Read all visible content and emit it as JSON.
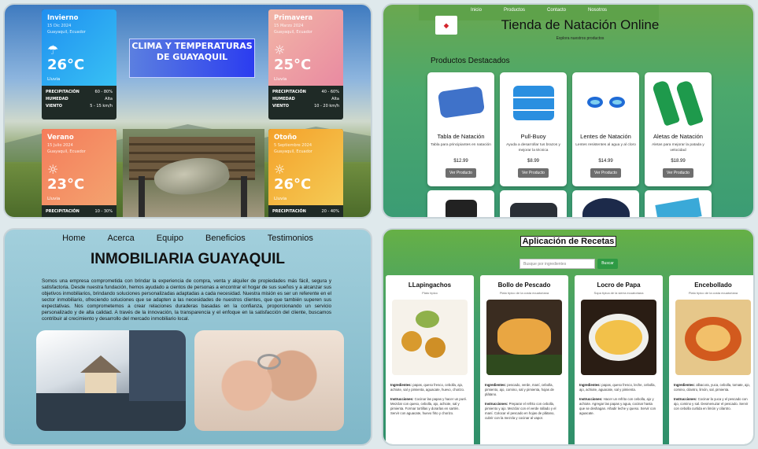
{
  "weather": {
    "title": "CLIMA Y TEMPERATURAS DE GUAYAQUIL",
    "cards": [
      {
        "season": "Invierno",
        "date": "15 Dic 2024",
        "place": "Guayaquil, Ecuador",
        "temp": "26°C",
        "cond": "Lluvia",
        "icon": "cloud-rain-icon",
        "rows": [
          {
            "k": "PRECIPITACIÓN",
            "v": "60 - 80%"
          },
          {
            "k": "HUMEDAD",
            "v": "Alta"
          },
          {
            "k": "VIENTO",
            "v": "5 - 15 km/h"
          }
        ]
      },
      {
        "season": "Primavera",
        "date": "15 Marzo 2024",
        "place": "Guayaquil, Ecuador",
        "temp": "25°C",
        "cond": "Lluvia",
        "icon": "sun-icon",
        "rows": [
          {
            "k": "PRECIPITACIÓN",
            "v": "40 - 60%"
          },
          {
            "k": "HUMEDAD",
            "v": "Alta"
          },
          {
            "k": "VIENTO",
            "v": "10 - 20 km/h"
          }
        ]
      },
      {
        "season": "Verano",
        "date": "15 Julio 2024",
        "place": "Guayaquil, Ecuador",
        "temp": "23°C",
        "cond": "Lluvia",
        "icon": "sun-icon",
        "rows": [
          {
            "k": "PRECIPITACIÓN",
            "v": "10 - 30%"
          }
        ]
      },
      {
        "season": "Otoño",
        "date": "5 Septiembre 2024",
        "place": "Guayaquil, Ecuador",
        "temp": "26°C",
        "cond": "Lluvia",
        "icon": "sun-icon",
        "rows": [
          {
            "k": "PRECIPITACIÓN",
            "v": "20 - 40%"
          }
        ]
      }
    ]
  },
  "store": {
    "nav": [
      "Inicio",
      "Productos",
      "Contacto",
      "Nosotros"
    ],
    "title": "Tienda de Natación Online",
    "subtitle": "Explora nuestros productos",
    "section": "Productos Destacados",
    "products": [
      {
        "name": "Tabla de Natación",
        "desc": "Tabla para principiantes en natación",
        "price": "$12.99",
        "button": "Ver Producto"
      },
      {
        "name": "Pull-Buoy",
        "desc": "Ayuda a desarrollar tus brazos y mejorar la técnica",
        "price": "$8.99",
        "button": "Ver Producto"
      },
      {
        "name": "Lentes de Natación",
        "desc": "Lentes resistentes al agua y al cloro",
        "price": "$14.99",
        "button": "Ver Producto"
      },
      {
        "name": "Aletas de Natación",
        "desc": "Aletas para mejorar la patada y velocidad",
        "price": "$18.99",
        "button": "Ver Producto"
      }
    ]
  },
  "realestate": {
    "nav": [
      "Home",
      "Acerca",
      "Equipo",
      "Beneficios",
      "Testimonios"
    ],
    "title": "INMOBILIARIA GUAYAQUIL",
    "paragraph": "Somos una empresa comprometida con brindar la experiencia de compra, venta y alquiler de propiedades más fácil, segura y satisfactoria. Desde nuestra fundación, hemos ayudado a cientos de personas a encontrar el hogar de sus sueños y a alcanzar sus objetivos inmobiliarios, brindando soluciones personalizadas adaptadas a cada necesidad. Nuestra misión es ser un referente en el sector inmobiliario, ofreciendo soluciones que se adapten a las necesidades de nuestros clientes, que que también superen sus expectativas. Nos comprometemos a crear relaciones duraderas basadas en la confianza, proporcionando un servicio personalizado y de alta calidad. A través de la innovación, la transparencia y el enfoque en la satisfacción del cliente, buscamos contribuir al crecimiento y desarrollo del mercado inmobiliario local."
  },
  "recipes": {
    "title": "Aplicación de Recetas",
    "search_placeholder": "Busque por ingredientes",
    "search_button": "Buscar",
    "items": [
      {
        "name": "LLapingachos",
        "sub": "Plato típico",
        "ing_label": "Ingredientes:",
        "ing": "papas, queso fresco, cebolla, ajo, achiote, sal y pimienta, aguacate, huevo, chorizo.",
        "ins_label": "Instrucciones:",
        "ins": "Cocinar las papas y hacer un puré. Mezclar con queso, cebolla, ajo, achiote, sal y pimienta. Formar tortillas y dorarlas en sartén. Servir con aguacate, huevo frito y chorizo."
      },
      {
        "name": "Bollo de Pescado",
        "sub": "Plato típico de la costa ecuatoriana",
        "ing_label": "Ingredientes:",
        "ing": "pescado, verde, maní, cebolla, pimiento, ajo, comino, sal y pimienta, hojas de plátano.",
        "ins_label": "Instrucciones:",
        "ins": "Preparar el refrito con cebolla, pimiento y ajo. Mezclar con el verde rallado y el maní. Colocar el pescado en hojas de plátano, cubrir con la mezcla y cocinar al vapor."
      },
      {
        "name": "Locro de Papa",
        "sub": "Sopa típica de la sierra ecuatoriana",
        "ing_label": "Ingredientes:",
        "ing": "papas, queso fresco, leche, cebolla, ajo, achiote, aguacate, sal y pimienta.",
        "ins_label": "Instrucciones:",
        "ins": "Hacer un refrito con cebolla, ajo y achiote. Agregar las papas y agua, cocinar hasta que se deshagan. Añadir leche y queso. Servir con aguacate."
      },
      {
        "name": "Encebollado",
        "sub": "Plato típico de la costa ecuatoriana",
        "ing_label": "Ingredientes:",
        "ing": "albacora, yuca, cebolla, tomate, ajo, comino, cilantro, limón, sal, pimienta.",
        "ins_label": "Instrucciones:",
        "ins": "Cocinar la yuca y el pescado con ajo, comino y sal. Desmenuzar el pescado. Servir con cebolla curtida en limón y cilantro."
      }
    ]
  }
}
